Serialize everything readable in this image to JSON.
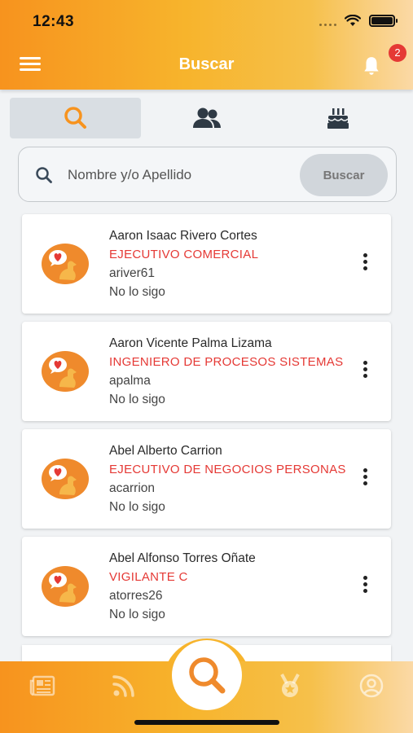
{
  "status_bar": {
    "time": "12:43"
  },
  "header": {
    "title": "Buscar",
    "notification_count": "2"
  },
  "tabs": [
    {
      "icon": "search-icon",
      "active": true
    },
    {
      "icon": "people-icon",
      "active": false
    },
    {
      "icon": "birthday-cake-icon",
      "active": false
    }
  ],
  "search": {
    "placeholder": "Nombre y/o Apellido",
    "button_label": "Buscar"
  },
  "results": [
    {
      "name": "Aaron Isaac Rivero Cortes",
      "role": "EJECUTIVO COMERCIAL",
      "username": "ariver61",
      "follow_status": "No lo sigo"
    },
    {
      "name": "Aaron Vicente Palma Lizama",
      "role": "INGENIERO DE PROCESOS SISTEMAS",
      "username": "apalma",
      "follow_status": "No lo sigo"
    },
    {
      "name": "Abel Alberto Carrion",
      "role": "EJECUTIVO DE NEGOCIOS PERSONAS",
      "username": "acarrion",
      "follow_status": "No lo sigo"
    },
    {
      "name": "Abel Alfonso Torres Oñate",
      "role": "VIGILANTE C",
      "username": "atorres26",
      "follow_status": "No lo sigo"
    }
  ],
  "bottom_nav": [
    "news-icon",
    "feed-icon",
    "search-icon",
    "medal-icon",
    "profile-icon"
  ],
  "colors": {
    "accent": "#f7931e",
    "role_text": "#e53935",
    "badge": "#e53935"
  }
}
